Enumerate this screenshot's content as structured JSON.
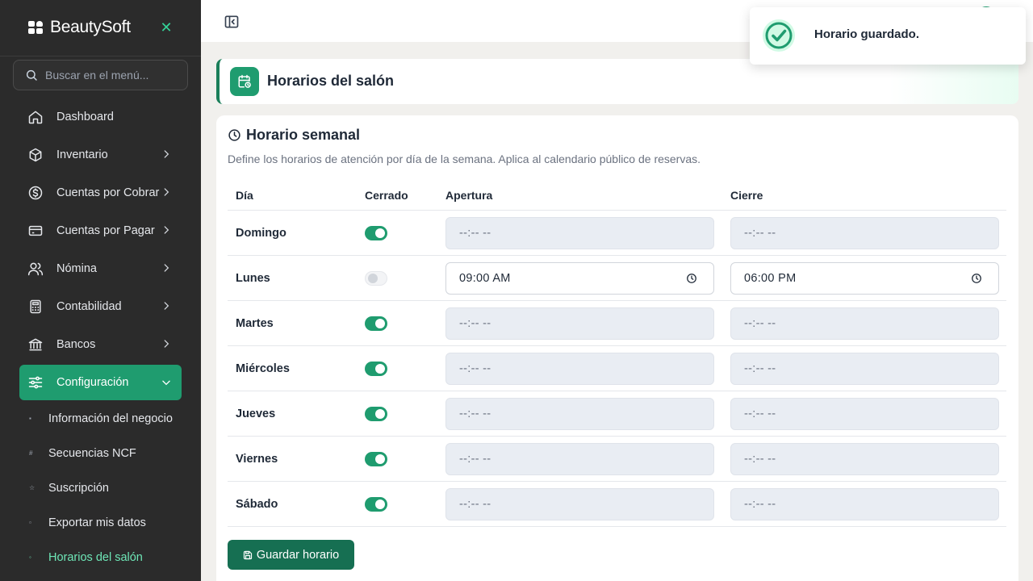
{
  "brand": {
    "name": "BeautySoft"
  },
  "search": {
    "placeholder": "Buscar en el menú..."
  },
  "sidebar": {
    "items": [
      {
        "label": "Dashboard",
        "icon": "home-icon"
      },
      {
        "label": "Inventario",
        "icon": "box-icon"
      },
      {
        "label": "Cuentas por Cobrar",
        "icon": "dollar-circle-icon"
      },
      {
        "label": "Cuentas por Pagar",
        "icon": "credit-card-icon"
      },
      {
        "label": "Nómina",
        "icon": "users-icon"
      },
      {
        "label": "Contabilidad",
        "icon": "calculator-icon"
      },
      {
        "label": "Bancos",
        "icon": "bank-icon"
      },
      {
        "label": "Configuración",
        "icon": "sliders-icon"
      }
    ],
    "subitems": [
      {
        "label": "Información del negocio"
      },
      {
        "label": "Secuencias NCF"
      },
      {
        "label": "Suscripción"
      },
      {
        "label": "Exportar mis datos"
      },
      {
        "label": "Horarios del salón"
      }
    ]
  },
  "page": {
    "title": "Horarios del salón"
  },
  "schedule": {
    "title": "Horario semanal",
    "description": "Define los horarios de atención por día de la semana. Aplica al calendario público de reservas.",
    "columns": {
      "day": "Día",
      "closed": "Cerrado",
      "open": "Apertura",
      "close": "Cierre"
    },
    "rows": [
      {
        "day": "Domingo",
        "closed": true,
        "open": "--:-- --",
        "close": "--:-- --"
      },
      {
        "day": "Lunes",
        "closed": false,
        "open": "09:00 AM",
        "close": "06:00 PM"
      },
      {
        "day": "Martes",
        "closed": true,
        "open": "--:-- --",
        "close": "--:-- --"
      },
      {
        "day": "Miércoles",
        "closed": true,
        "open": "--:-- --",
        "close": "--:-- --"
      },
      {
        "day": "Jueves",
        "closed": true,
        "open": "--:-- --",
        "close": "--:-- --"
      },
      {
        "day": "Viernes",
        "closed": true,
        "open": "--:-- --",
        "close": "--:-- --"
      },
      {
        "day": "Sábado",
        "closed": true,
        "open": "--:-- --",
        "close": "--:-- --"
      }
    ],
    "save_label": "Guardar horario"
  },
  "toast": {
    "message": "Horario guardado."
  },
  "colors": {
    "accent": "#1f9c6f",
    "sidebar_bg": "#2b2b2b",
    "button": "#166f52"
  }
}
